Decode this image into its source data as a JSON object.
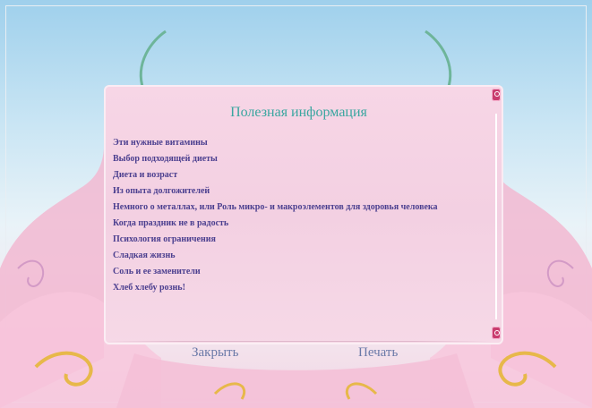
{
  "panel": {
    "title": "Полезная информация"
  },
  "topics": [
    "Эти нужные витамины",
    "Выбор подходящей диеты",
    "Диета и возраст",
    "Из опыта долгожителей",
    "Немного о металлах, или Роль микро- и макроэлементов для здоровья человека",
    "Когда праздник не в радость",
    "Психология ограничения",
    "Сладкая жизнь",
    "Соль и ее заменители",
    "Хлеб хлебу рознь!"
  ],
  "buttons": {
    "close_label": "Закрыть",
    "print_label": "Печать"
  },
  "icons": {
    "scroll_up": "scroll-up-icon",
    "scroll_down": "scroll-down-icon"
  },
  "colors": {
    "title": "#3aa6a0",
    "topic_text": "#4b3f8f",
    "button_text": "#6a79a8",
    "panel_bg": "#f3d0e2",
    "scroll_buttons": "#c93c6e"
  }
}
